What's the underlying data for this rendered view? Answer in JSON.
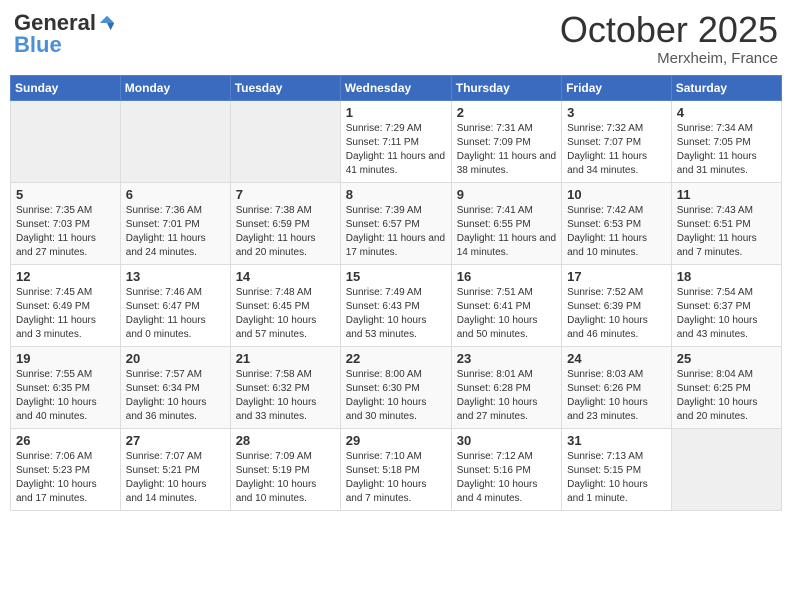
{
  "header": {
    "logo": {
      "part1": "General",
      "part2": "Blue"
    },
    "month": "October 2025",
    "location": "Merxheim, France"
  },
  "weekdays": [
    "Sunday",
    "Monday",
    "Tuesday",
    "Wednesday",
    "Thursday",
    "Friday",
    "Saturday"
  ],
  "weeks": [
    [
      {
        "day": null
      },
      {
        "day": null
      },
      {
        "day": null
      },
      {
        "day": "1",
        "sunrise": "Sunrise: 7:29 AM",
        "sunset": "Sunset: 7:11 PM",
        "daylight": "Daylight: 11 hours and 41 minutes."
      },
      {
        "day": "2",
        "sunrise": "Sunrise: 7:31 AM",
        "sunset": "Sunset: 7:09 PM",
        "daylight": "Daylight: 11 hours and 38 minutes."
      },
      {
        "day": "3",
        "sunrise": "Sunrise: 7:32 AM",
        "sunset": "Sunset: 7:07 PM",
        "daylight": "Daylight: 11 hours and 34 minutes."
      },
      {
        "day": "4",
        "sunrise": "Sunrise: 7:34 AM",
        "sunset": "Sunset: 7:05 PM",
        "daylight": "Daylight: 11 hours and 31 minutes."
      }
    ],
    [
      {
        "day": "5",
        "sunrise": "Sunrise: 7:35 AM",
        "sunset": "Sunset: 7:03 PM",
        "daylight": "Daylight: 11 hours and 27 minutes."
      },
      {
        "day": "6",
        "sunrise": "Sunrise: 7:36 AM",
        "sunset": "Sunset: 7:01 PM",
        "daylight": "Daylight: 11 hours and 24 minutes."
      },
      {
        "day": "7",
        "sunrise": "Sunrise: 7:38 AM",
        "sunset": "Sunset: 6:59 PM",
        "daylight": "Daylight: 11 hours and 20 minutes."
      },
      {
        "day": "8",
        "sunrise": "Sunrise: 7:39 AM",
        "sunset": "Sunset: 6:57 PM",
        "daylight": "Daylight: 11 hours and 17 minutes."
      },
      {
        "day": "9",
        "sunrise": "Sunrise: 7:41 AM",
        "sunset": "Sunset: 6:55 PM",
        "daylight": "Daylight: 11 hours and 14 minutes."
      },
      {
        "day": "10",
        "sunrise": "Sunrise: 7:42 AM",
        "sunset": "Sunset: 6:53 PM",
        "daylight": "Daylight: 11 hours and 10 minutes."
      },
      {
        "day": "11",
        "sunrise": "Sunrise: 7:43 AM",
        "sunset": "Sunset: 6:51 PM",
        "daylight": "Daylight: 11 hours and 7 minutes."
      }
    ],
    [
      {
        "day": "12",
        "sunrise": "Sunrise: 7:45 AM",
        "sunset": "Sunset: 6:49 PM",
        "daylight": "Daylight: 11 hours and 3 minutes."
      },
      {
        "day": "13",
        "sunrise": "Sunrise: 7:46 AM",
        "sunset": "Sunset: 6:47 PM",
        "daylight": "Daylight: 11 hours and 0 minutes."
      },
      {
        "day": "14",
        "sunrise": "Sunrise: 7:48 AM",
        "sunset": "Sunset: 6:45 PM",
        "daylight": "Daylight: 10 hours and 57 minutes."
      },
      {
        "day": "15",
        "sunrise": "Sunrise: 7:49 AM",
        "sunset": "Sunset: 6:43 PM",
        "daylight": "Daylight: 10 hours and 53 minutes."
      },
      {
        "day": "16",
        "sunrise": "Sunrise: 7:51 AM",
        "sunset": "Sunset: 6:41 PM",
        "daylight": "Daylight: 10 hours and 50 minutes."
      },
      {
        "day": "17",
        "sunrise": "Sunrise: 7:52 AM",
        "sunset": "Sunset: 6:39 PM",
        "daylight": "Daylight: 10 hours and 46 minutes."
      },
      {
        "day": "18",
        "sunrise": "Sunrise: 7:54 AM",
        "sunset": "Sunset: 6:37 PM",
        "daylight": "Daylight: 10 hours and 43 minutes."
      }
    ],
    [
      {
        "day": "19",
        "sunrise": "Sunrise: 7:55 AM",
        "sunset": "Sunset: 6:35 PM",
        "daylight": "Daylight: 10 hours and 40 minutes."
      },
      {
        "day": "20",
        "sunrise": "Sunrise: 7:57 AM",
        "sunset": "Sunset: 6:34 PM",
        "daylight": "Daylight: 10 hours and 36 minutes."
      },
      {
        "day": "21",
        "sunrise": "Sunrise: 7:58 AM",
        "sunset": "Sunset: 6:32 PM",
        "daylight": "Daylight: 10 hours and 33 minutes."
      },
      {
        "day": "22",
        "sunrise": "Sunrise: 8:00 AM",
        "sunset": "Sunset: 6:30 PM",
        "daylight": "Daylight: 10 hours and 30 minutes."
      },
      {
        "day": "23",
        "sunrise": "Sunrise: 8:01 AM",
        "sunset": "Sunset: 6:28 PM",
        "daylight": "Daylight: 10 hours and 27 minutes."
      },
      {
        "day": "24",
        "sunrise": "Sunrise: 8:03 AM",
        "sunset": "Sunset: 6:26 PM",
        "daylight": "Daylight: 10 hours and 23 minutes."
      },
      {
        "day": "25",
        "sunrise": "Sunrise: 8:04 AM",
        "sunset": "Sunset: 6:25 PM",
        "daylight": "Daylight: 10 hours and 20 minutes."
      }
    ],
    [
      {
        "day": "26",
        "sunrise": "Sunrise: 7:06 AM",
        "sunset": "Sunset: 5:23 PM",
        "daylight": "Daylight: 10 hours and 17 minutes."
      },
      {
        "day": "27",
        "sunrise": "Sunrise: 7:07 AM",
        "sunset": "Sunset: 5:21 PM",
        "daylight": "Daylight: 10 hours and 14 minutes."
      },
      {
        "day": "28",
        "sunrise": "Sunrise: 7:09 AM",
        "sunset": "Sunset: 5:19 PM",
        "daylight": "Daylight: 10 hours and 10 minutes."
      },
      {
        "day": "29",
        "sunrise": "Sunrise: 7:10 AM",
        "sunset": "Sunset: 5:18 PM",
        "daylight": "Daylight: 10 hours and 7 minutes."
      },
      {
        "day": "30",
        "sunrise": "Sunrise: 7:12 AM",
        "sunset": "Sunset: 5:16 PM",
        "daylight": "Daylight: 10 hours and 4 minutes."
      },
      {
        "day": "31",
        "sunrise": "Sunrise: 7:13 AM",
        "sunset": "Sunset: 5:15 PM",
        "daylight": "Daylight: 10 hours and 1 minute."
      },
      {
        "day": null
      }
    ]
  ]
}
